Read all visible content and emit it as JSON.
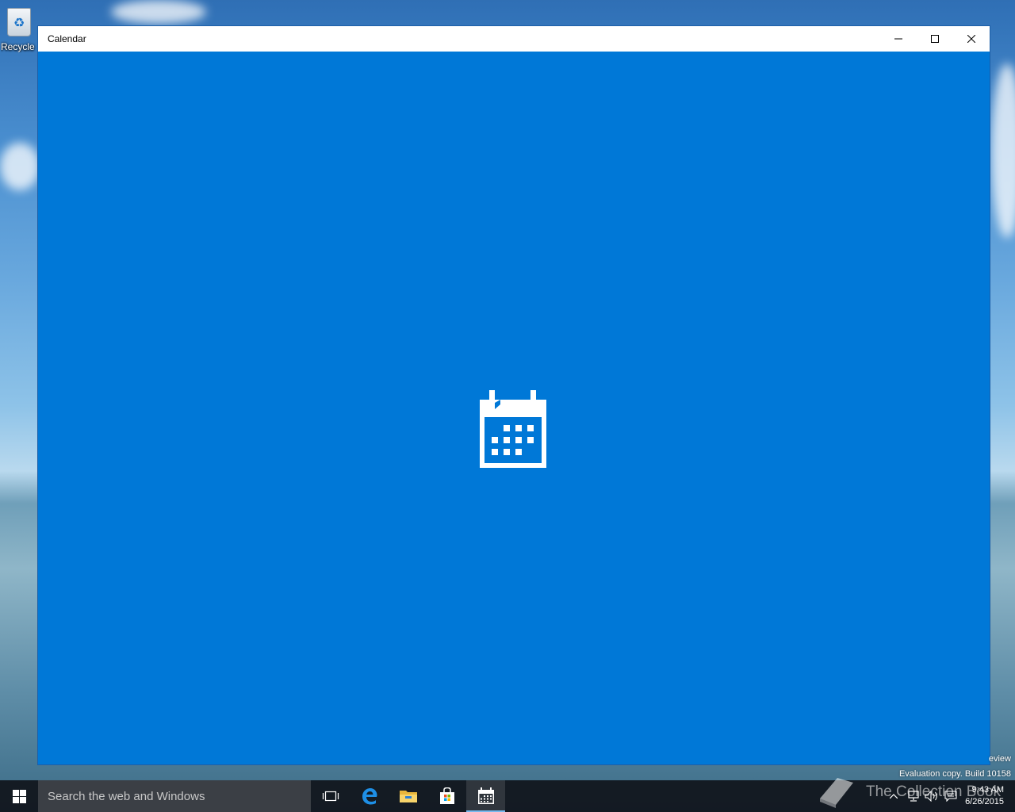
{
  "desktop": {
    "recycle_bin_label": "Recycle"
  },
  "window": {
    "title": "Calendar",
    "minimize_symbol": "—",
    "maximize_symbol": "☐",
    "close_symbol": "✕",
    "accent_color": "#0078d7",
    "splash_icon": "calendar-icon"
  },
  "watermark": {
    "line1": "eview",
    "line2": "Evaluation copy. Build 10158"
  },
  "taskbar": {
    "search_placeholder": "Search the web and Windows",
    "pinned": [
      "task-view-icon",
      "edge-icon",
      "file-explorer-icon",
      "store-icon",
      "calendar-icon"
    ],
    "clock_time": "9:43 AM",
    "clock_date": "6/26/2015"
  },
  "overlay": {
    "brand_text": "The Collection Book"
  }
}
